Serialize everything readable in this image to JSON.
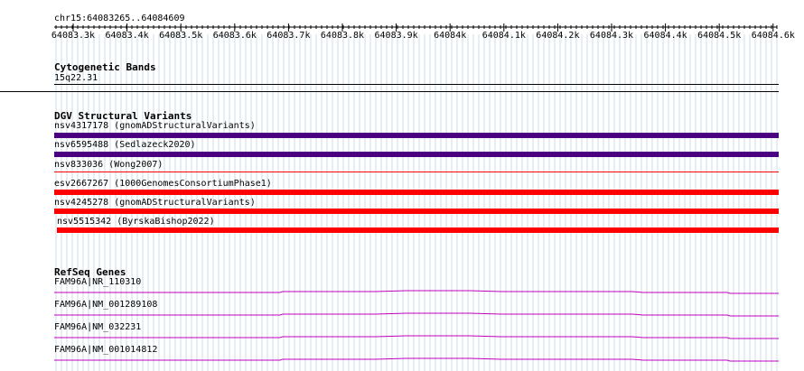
{
  "locus": "chr15:64083265..64084609",
  "ruler": {
    "ticks": [
      "64083.3k",
      "64083.4k",
      "64083.5k",
      "64083.6k",
      "64083.7k",
      "64083.8k",
      "64083.9k",
      "64084k",
      "64084.1k",
      "64084.2k",
      "64084.3k",
      "64084.4k",
      "64084.5k",
      "64084.6k"
    ]
  },
  "tracks": {
    "cytoband": {
      "title": "Cytogenetic Bands",
      "band": "15q22.31"
    },
    "dgv": {
      "title": "DGV Structural Variants",
      "features": [
        {
          "label": "nsv4317178 (gnomADStructuralVariants)",
          "color": "#4b0082"
        },
        {
          "label": "nsv6595488 (Sedlazeck2020)",
          "color": "#4b0082"
        },
        {
          "label": "nsv833036 (Wong2007)",
          "color": "#ff0000"
        },
        {
          "label": "esv2667267 (1000GenomesConsortiumPhase1)",
          "color": "#ff0000"
        },
        {
          "label": "nsv4245278 (gnomADStructuralVariants)",
          "color": "#ff0000"
        },
        {
          "label": "nsv5515342 (ByrskaBishop2022)",
          "color": "#ff0000"
        }
      ]
    },
    "refseq": {
      "title": "RefSeq Genes",
      "genes": [
        {
          "label": "FAM96A|NR_110310",
          "color": "#c000c0"
        },
        {
          "label": "FAM96A|NM_001289108",
          "color": "#c000c0"
        },
        {
          "label": "FAM96A|NM_032231",
          "color": "#c000c0"
        },
        {
          "label": "FAM96A|NM_001014812",
          "color": "#c000c0"
        }
      ]
    }
  }
}
